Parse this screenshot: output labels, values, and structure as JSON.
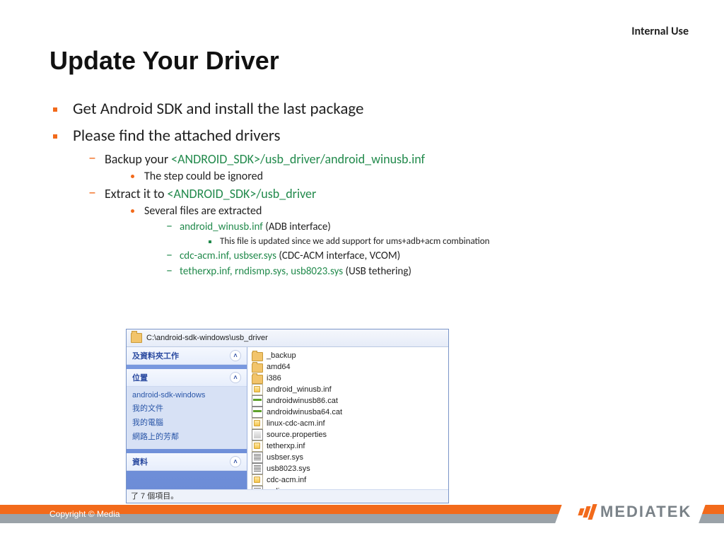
{
  "classification": "Internal Use",
  "title": "Update Your Driver",
  "bullets": {
    "l1a": "Get Android SDK and install the last package",
    "l1b": "Please find the attached drivers",
    "l2a_pre": "Backup your ",
    "l2a_path": "<ANDROID_SDK>/usb_driver/android_winusb.inf",
    "l3a": "The step could be ignored",
    "l2b_pre": "Extract it to ",
    "l2b_path": "<ANDROID_SDK>/usb_driver",
    "l3b": "Several files are extracted",
    "l4a_file": "android_winusb.inf",
    "l4a_desc": " (ADB interface)",
    "l5a": "This file is updated since we add support for ums+adb+acm combination",
    "l4b_file": "cdc-acm.inf, usbser.sys",
    "l4b_desc": " (CDC-ACM interface, VCOM)",
    "l4c_file": "tetherxp.inf, rndismp.sys, usb8023.sys",
    "l4c_desc": " (USB tethering)"
  },
  "explorer": {
    "address": "C:\\android-sdk-windows\\usb_driver",
    "panel1_title": "及資料夾工作",
    "panel2_title": "位置",
    "links": [
      "android-sdk-windows",
      "我的文件",
      "我的電腦",
      "網路上的芳鄰"
    ],
    "panel3_title": "資料",
    "status": "了 7 個項目。",
    "files": [
      {
        "icon": "fld",
        "name": "_backup"
      },
      {
        "icon": "fld",
        "name": "amd64"
      },
      {
        "icon": "fld",
        "name": "i386"
      },
      {
        "icon": "inf",
        "name": "android_winusb.inf"
      },
      {
        "icon": "cat",
        "name": "androidwinusb86.cat"
      },
      {
        "icon": "cat",
        "name": "androidwinusba64.cat"
      },
      {
        "icon": "inf",
        "name": "linux-cdc-acm.inf"
      },
      {
        "icon": "prop",
        "name": "source.properties"
      },
      {
        "icon": "inf",
        "name": "tetherxp.inf"
      },
      {
        "icon": "sys",
        "name": "usbser.sys"
      },
      {
        "icon": "sys",
        "name": "usb8023.sys"
      },
      {
        "icon": "inf",
        "name": "cdc-acm.inf"
      },
      {
        "icon": "sys",
        "name": "rndismp.sys"
      }
    ]
  },
  "footer": {
    "copyright": "Copyright © Media",
    "logo_text": "MEDIATEK"
  }
}
